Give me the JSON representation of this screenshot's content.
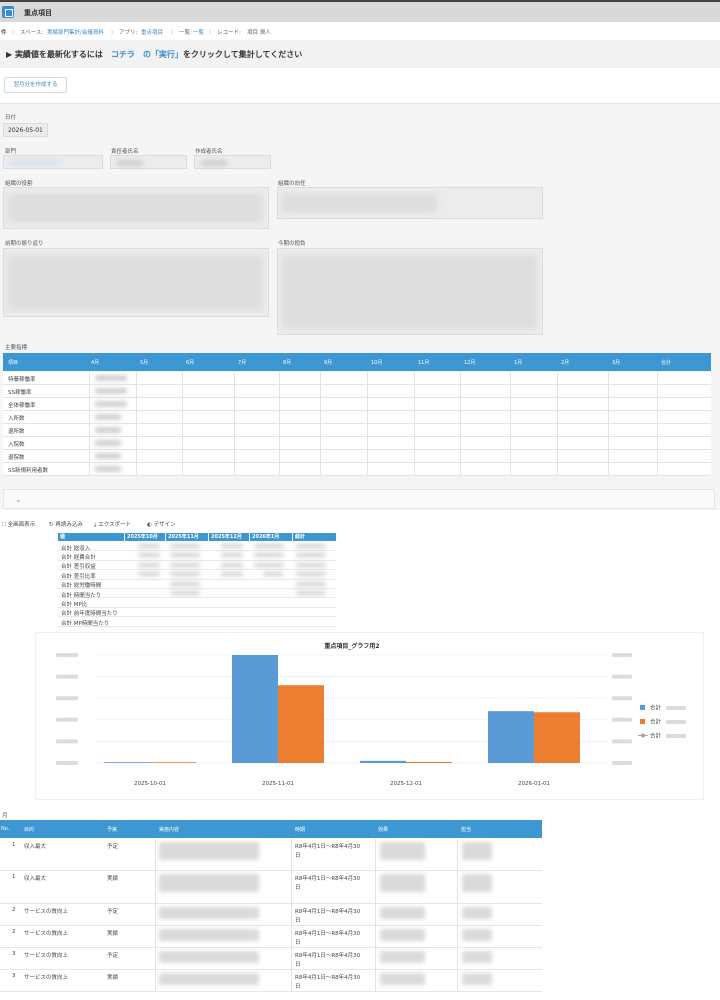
{
  "app": {
    "title": "重点項目"
  },
  "breadcrumb": {
    "home": "件",
    "space_label": "スペース:",
    "space": "実績部門集計/会議資料",
    "app_label": "アプリ:",
    "app": "重点項目",
    "view_label": "一覧:",
    "view": "一覧",
    "record_label": "レコード:",
    "record": "項目 潤人"
  },
  "banner": {
    "prefix": "▶ 実績値を最新化するには",
    "link": "コチラ",
    "middle": "の「実行」",
    "suffix": "をクリックして集計してください"
  },
  "action": {
    "create_label": "翌月分を作成する"
  },
  "form": {
    "date_label": "日付",
    "date_value": "2026-05-01",
    "dept_label": "部門",
    "responsible_label": "責任者氏名",
    "author_label": "作成者氏名",
    "role_label": "組織の役割",
    "direction_label": "組織の向任",
    "review_label": "前期の振り返り",
    "resolve_label": "今期の抱負",
    "kpi_label": "主要指標"
  },
  "kpi_table": {
    "columns": [
      "項目",
      "4月",
      "5月",
      "6月",
      "7月",
      "8月",
      "9月",
      "10月",
      "11月",
      "12月",
      "1月",
      "2月",
      "3月",
      "合計"
    ],
    "rows": [
      "特養稼働率",
      "SS稼働率",
      "全体稼働率",
      "入所数",
      "退所数",
      "入院数",
      "退院数",
      "SS新規利用者数"
    ]
  },
  "toolbar": {
    "fullscreen": "全画面表示",
    "reload": "再読み込み",
    "export": "エクスポート",
    "design": "デザイン"
  },
  "pivot": {
    "columns": [
      "値",
      "2025年10月",
      "2025年11月",
      "2025年12月",
      "2026年1月",
      "総計"
    ],
    "rows": [
      "合計 総収入",
      "合計 経費合計",
      "合計 差引収益",
      "合計 差引比率",
      "合計 総労働時間",
      "合計 時間当たり",
      "合計 MP比",
      "合計 前年度時間当たり",
      "合計 MP時間当たり"
    ]
  },
  "chart_data": {
    "type": "bar",
    "title": "重点項目_グラフ用2",
    "categories": [
      "2025-10-01",
      "2025-11-01",
      "2025-12-01",
      "2026-01-01"
    ],
    "series": [
      {
        "name": "合計",
        "values": [
          0,
          100,
          2,
          48
        ],
        "color": "#5b9bd5"
      },
      {
        "name": "合計",
        "values": [
          0,
          72,
          1,
          47
        ],
        "color": "#ed7d31"
      },
      {
        "name": "合計",
        "values": [
          0,
          0,
          0,
          0
        ],
        "color": "#a5a5a5"
      }
    ],
    "ylim": [
      0,
      100
    ],
    "legend": "right"
  },
  "section2": {
    "label": "月"
  },
  "table2": {
    "columns": [
      "No.",
      "目的",
      "予実",
      "実施内容",
      "時期",
      "効果",
      "担当"
    ],
    "rows": [
      {
        "no": "1",
        "purpose": "収入最大",
        "type": "予定",
        "period1": "R8年4月1日～R8年4月30",
        "period2": "日"
      },
      {
        "no": "1",
        "purpose": "収入最大",
        "type": "実績",
        "period1": "R8年4月1日～R8年4月30",
        "period2": "日"
      },
      {
        "no": "2",
        "purpose": "サービスの質向上",
        "type": "予定",
        "period1": "R8年4月1日～R8年4月30",
        "period2": "日"
      },
      {
        "no": "2",
        "purpose": "サービスの質向上",
        "type": "実績",
        "period1": "R8年4月1日～R8年4月30",
        "period2": "日"
      },
      {
        "no": "3",
        "purpose": "サービスの質向上",
        "type": "予定",
        "period1": "R8年4月1日～R8年4月30",
        "period2": "日"
      },
      {
        "no": "3",
        "purpose": "サービスの質向上",
        "type": "実績",
        "period1": "R8年4月1日～R8年4月30",
        "period2": "日"
      }
    ]
  }
}
